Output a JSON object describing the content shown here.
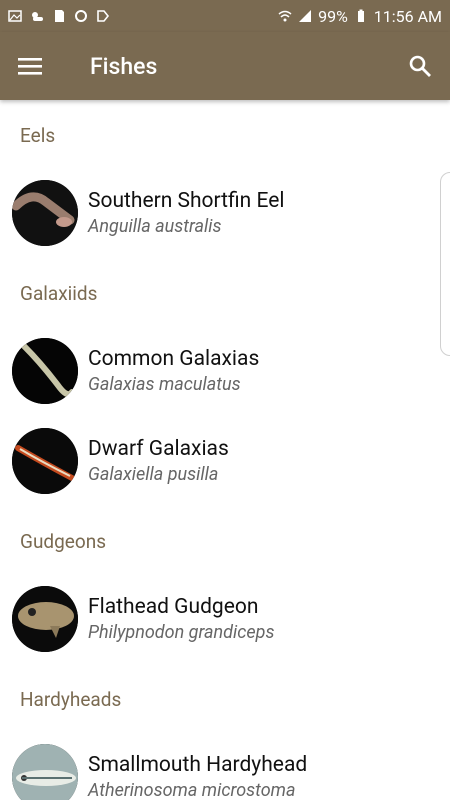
{
  "status": {
    "battery": "99%",
    "time": "11:56 AM"
  },
  "appbar": {
    "title": "Fishes"
  },
  "colors": {
    "brand": "#7a6a51",
    "text": "#111111",
    "subtext": "#666666"
  },
  "sections": [
    {
      "title": "Eels",
      "items": [
        {
          "common": "Southern Shortfin Eel",
          "scientific": "Anguilla australis"
        }
      ]
    },
    {
      "title": "Galaxiids",
      "items": [
        {
          "common": "Common Galaxias",
          "scientific": "Galaxias maculatus"
        },
        {
          "common": "Dwarf Galaxias",
          "scientific": "Galaxiella pusilla"
        }
      ]
    },
    {
      "title": "Gudgeons",
      "items": [
        {
          "common": "Flathead Gudgeon",
          "scientific": "Philypnodon grandiceps"
        }
      ]
    },
    {
      "title": "Hardyheads",
      "items": [
        {
          "common": "Smallmouth Hardyhead",
          "scientific": "Atherinosoma microstoma"
        }
      ]
    }
  ]
}
